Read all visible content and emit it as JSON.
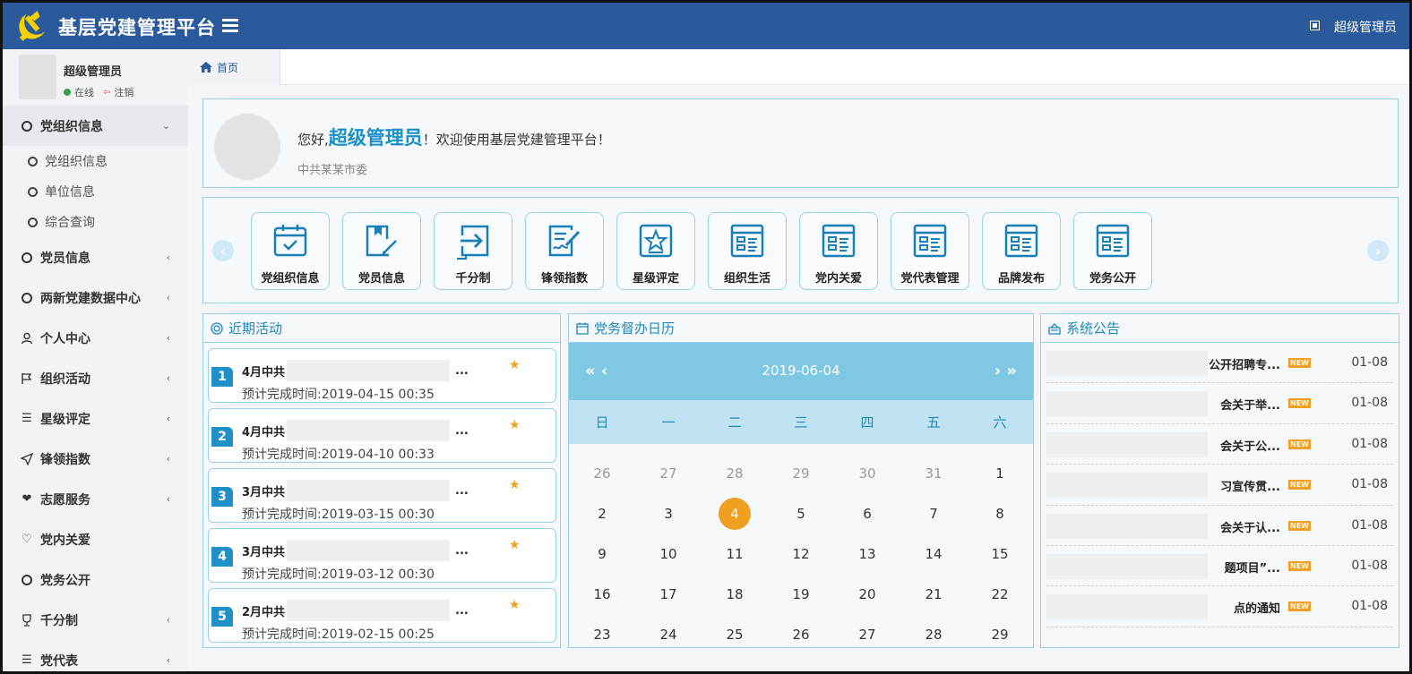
{
  "header": {
    "app_title": "基层党建管理平台",
    "user_name": "超级管理员"
  },
  "sidebar": {
    "profile": {
      "name": "超级管理员",
      "status": "在线",
      "logout": "注销"
    },
    "menu": [
      {
        "label": "党组织信息",
        "icon": "circle-icon",
        "open": true,
        "children": [
          {
            "label": "党组织信息"
          },
          {
            "label": "单位信息"
          },
          {
            "label": "综合查询"
          }
        ]
      },
      {
        "label": "党员信息",
        "icon": "circle-icon"
      },
      {
        "label": "两新党建数据中心",
        "icon": "circle-icon"
      },
      {
        "label": "个人中心",
        "icon": "user-icon"
      },
      {
        "label": "组织活动",
        "icon": "flag-icon"
      },
      {
        "label": "星级评定",
        "icon": "list-icon"
      },
      {
        "label": "锋领指数",
        "icon": "send-icon"
      },
      {
        "label": "志愿服务",
        "icon": "heart-icon"
      },
      {
        "label": "党内关爱",
        "icon": "heart-outline-icon"
      },
      {
        "label": "党务公开",
        "icon": "circle-icon"
      },
      {
        "label": "千分制",
        "icon": "trophy-icon"
      },
      {
        "label": "党代表",
        "icon": "list-icon"
      }
    ]
  },
  "tabs": {
    "home": "首页"
  },
  "welcome": {
    "prefix": "您好,",
    "name": "超级管理员",
    "suffix": "！欢迎使用基层党建管理平台！",
    "org": "中共某某市委"
  },
  "shortcuts": [
    {
      "label": "党组织信息",
      "icon": "calendar-check-icon"
    },
    {
      "label": "党员信息",
      "icon": "file-edit-icon"
    },
    {
      "label": "千分制",
      "icon": "enter-icon"
    },
    {
      "label": "锋领指数",
      "icon": "sign-doc-icon"
    },
    {
      "label": "星级评定",
      "icon": "star-box-icon"
    },
    {
      "label": "组织生活",
      "icon": "form-icon"
    },
    {
      "label": "党内关爱",
      "icon": "form-icon"
    },
    {
      "label": "党代表管理",
      "icon": "form-icon"
    },
    {
      "label": "品牌发布",
      "icon": "form-icon"
    },
    {
      "label": "党务公开",
      "icon": "form-icon"
    }
  ],
  "activities": {
    "title": "近期活动",
    "time_label": "预计完成时间:",
    "items": [
      {
        "num": "1",
        "title": "4月中共",
        "ellipsis": "...",
        "time": "2019-04-15 00:35"
      },
      {
        "num": "2",
        "title": "4月中共",
        "ellipsis": "...",
        "time": "2019-04-10 00:33"
      },
      {
        "num": "3",
        "title": "3月中共",
        "ellipsis": "...",
        "time": "2019-03-15 00:30"
      },
      {
        "num": "4",
        "title": "3月中共",
        "ellipsis": "...",
        "time": "2019-03-12 00:30"
      },
      {
        "num": "5",
        "title": "2月中共",
        "ellipsis": "...",
        "time": "2019-02-15 00:25"
      }
    ]
  },
  "calendar": {
    "title": "党务督办日历",
    "current_date": "2019-06-04",
    "prev_label": "« ‹",
    "next_label": "› »",
    "weekdays": [
      "日",
      "一",
      "二",
      "三",
      "四",
      "五",
      "六"
    ],
    "days": [
      {
        "d": "26",
        "m": true
      },
      {
        "d": "27",
        "m": true
      },
      {
        "d": "28",
        "m": true
      },
      {
        "d": "29",
        "m": true
      },
      {
        "d": "30",
        "m": true
      },
      {
        "d": "31",
        "m": true
      },
      {
        "d": "1"
      },
      {
        "d": "2"
      },
      {
        "d": "3"
      },
      {
        "d": "4",
        "today": true
      },
      {
        "d": "5"
      },
      {
        "d": "6"
      },
      {
        "d": "7"
      },
      {
        "d": "8"
      },
      {
        "d": "9"
      },
      {
        "d": "10"
      },
      {
        "d": "11"
      },
      {
        "d": "12"
      },
      {
        "d": "13"
      },
      {
        "d": "14"
      },
      {
        "d": "15"
      },
      {
        "d": "16"
      },
      {
        "d": "17"
      },
      {
        "d": "18"
      },
      {
        "d": "19"
      },
      {
        "d": "20"
      },
      {
        "d": "21"
      },
      {
        "d": "22"
      },
      {
        "d": "23"
      },
      {
        "d": "24"
      },
      {
        "d": "25"
      },
      {
        "d": "26"
      },
      {
        "d": "27"
      },
      {
        "d": "28"
      },
      {
        "d": "29"
      }
    ]
  },
  "notices": {
    "title": "系统公告",
    "badge": "NEW",
    "items": [
      {
        "title": "公开招聘专...",
        "date": "01-08"
      },
      {
        "title": "会关于举...",
        "date": "01-08"
      },
      {
        "title": "会关于公...",
        "date": "01-08"
      },
      {
        "title": "习宣传贯...",
        "date": "01-08"
      },
      {
        "title": "会关于认...",
        "date": "01-08"
      },
      {
        "title": "题项目”...",
        "date": "01-08"
      },
      {
        "title": "点的通知",
        "date": "01-08"
      }
    ]
  },
  "colors": {
    "brand": "#2a5a9c",
    "accent": "#1a8fc9",
    "highlight": "#f0a020",
    "border": "#9ad2e8"
  }
}
